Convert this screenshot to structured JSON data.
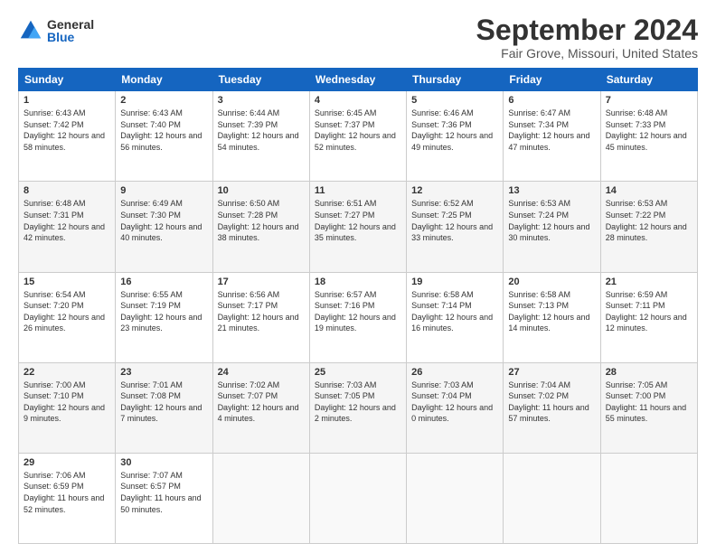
{
  "header": {
    "logo_general": "General",
    "logo_blue": "Blue",
    "month_title": "September 2024",
    "location": "Fair Grove, Missouri, United States"
  },
  "days_of_week": [
    "Sunday",
    "Monday",
    "Tuesday",
    "Wednesday",
    "Thursday",
    "Friday",
    "Saturday"
  ],
  "weeks": [
    [
      {
        "day": "1",
        "sunrise": "6:43 AM",
        "sunset": "7:42 PM",
        "daylight": "12 hours and 58 minutes."
      },
      {
        "day": "2",
        "sunrise": "6:43 AM",
        "sunset": "7:40 PM",
        "daylight": "12 hours and 56 minutes."
      },
      {
        "day": "3",
        "sunrise": "6:44 AM",
        "sunset": "7:39 PM",
        "daylight": "12 hours and 54 minutes."
      },
      {
        "day": "4",
        "sunrise": "6:45 AM",
        "sunset": "7:37 PM",
        "daylight": "12 hours and 52 minutes."
      },
      {
        "day": "5",
        "sunrise": "6:46 AM",
        "sunset": "7:36 PM",
        "daylight": "12 hours and 49 minutes."
      },
      {
        "day": "6",
        "sunrise": "6:47 AM",
        "sunset": "7:34 PM",
        "daylight": "12 hours and 47 minutes."
      },
      {
        "day": "7",
        "sunrise": "6:48 AM",
        "sunset": "7:33 PM",
        "daylight": "12 hours and 45 minutes."
      }
    ],
    [
      {
        "day": "8",
        "sunrise": "6:48 AM",
        "sunset": "7:31 PM",
        "daylight": "12 hours and 42 minutes."
      },
      {
        "day": "9",
        "sunrise": "6:49 AM",
        "sunset": "7:30 PM",
        "daylight": "12 hours and 40 minutes."
      },
      {
        "day": "10",
        "sunrise": "6:50 AM",
        "sunset": "7:28 PM",
        "daylight": "12 hours and 38 minutes."
      },
      {
        "day": "11",
        "sunrise": "6:51 AM",
        "sunset": "7:27 PM",
        "daylight": "12 hours and 35 minutes."
      },
      {
        "day": "12",
        "sunrise": "6:52 AM",
        "sunset": "7:25 PM",
        "daylight": "12 hours and 33 minutes."
      },
      {
        "day": "13",
        "sunrise": "6:53 AM",
        "sunset": "7:24 PM",
        "daylight": "12 hours and 30 minutes."
      },
      {
        "day": "14",
        "sunrise": "6:53 AM",
        "sunset": "7:22 PM",
        "daylight": "12 hours and 28 minutes."
      }
    ],
    [
      {
        "day": "15",
        "sunrise": "6:54 AM",
        "sunset": "7:20 PM",
        "daylight": "12 hours and 26 minutes."
      },
      {
        "day": "16",
        "sunrise": "6:55 AM",
        "sunset": "7:19 PM",
        "daylight": "12 hours and 23 minutes."
      },
      {
        "day": "17",
        "sunrise": "6:56 AM",
        "sunset": "7:17 PM",
        "daylight": "12 hours and 21 minutes."
      },
      {
        "day": "18",
        "sunrise": "6:57 AM",
        "sunset": "7:16 PM",
        "daylight": "12 hours and 19 minutes."
      },
      {
        "day": "19",
        "sunrise": "6:58 AM",
        "sunset": "7:14 PM",
        "daylight": "12 hours and 16 minutes."
      },
      {
        "day": "20",
        "sunrise": "6:58 AM",
        "sunset": "7:13 PM",
        "daylight": "12 hours and 14 minutes."
      },
      {
        "day": "21",
        "sunrise": "6:59 AM",
        "sunset": "7:11 PM",
        "daylight": "12 hours and 12 minutes."
      }
    ],
    [
      {
        "day": "22",
        "sunrise": "7:00 AM",
        "sunset": "7:10 PM",
        "daylight": "12 hours and 9 minutes."
      },
      {
        "day": "23",
        "sunrise": "7:01 AM",
        "sunset": "7:08 PM",
        "daylight": "12 hours and 7 minutes."
      },
      {
        "day": "24",
        "sunrise": "7:02 AM",
        "sunset": "7:07 PM",
        "daylight": "12 hours and 4 minutes."
      },
      {
        "day": "25",
        "sunrise": "7:03 AM",
        "sunset": "7:05 PM",
        "daylight": "12 hours and 2 minutes."
      },
      {
        "day": "26",
        "sunrise": "7:03 AM",
        "sunset": "7:04 PM",
        "daylight": "12 hours and 0 minutes."
      },
      {
        "day": "27",
        "sunrise": "7:04 AM",
        "sunset": "7:02 PM",
        "daylight": "11 hours and 57 minutes."
      },
      {
        "day": "28",
        "sunrise": "7:05 AM",
        "sunset": "7:00 PM",
        "daylight": "11 hours and 55 minutes."
      }
    ],
    [
      {
        "day": "29",
        "sunrise": "7:06 AM",
        "sunset": "6:59 PM",
        "daylight": "11 hours and 52 minutes."
      },
      {
        "day": "30",
        "sunrise": "7:07 AM",
        "sunset": "6:57 PM",
        "daylight": "11 hours and 50 minutes."
      },
      null,
      null,
      null,
      null,
      null
    ]
  ]
}
